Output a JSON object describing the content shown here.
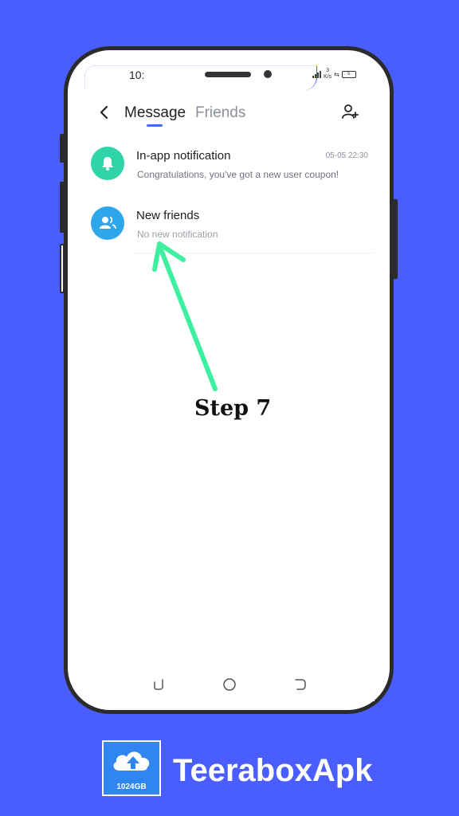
{
  "status_bar": {
    "time": "10:",
    "network_speed_value": "3",
    "network_speed_unit": "K/s",
    "battery_level": "5"
  },
  "header": {
    "tabs": [
      {
        "label": "Message",
        "active": true
      },
      {
        "label": "Friends",
        "active": false
      }
    ]
  },
  "notifications": [
    {
      "title": "In-app notification",
      "subtitle": "Congratulations, you've got a new user coupon!",
      "timestamp": "05-05  22:30",
      "icon": "bell-icon",
      "color": "#2fd5a8"
    },
    {
      "title": "New friends",
      "subtitle": "No new notification",
      "timestamp": "",
      "icon": "people-icon",
      "color": "#2ea6ea"
    }
  ],
  "annotation": {
    "label": "Step 7",
    "arrow_color": "#3df0a0"
  },
  "branding": {
    "logo_caption": "1024GB",
    "name": "TeeraboxApk"
  },
  "colors": {
    "background": "#4a5dff",
    "accent": "#3b6df5"
  }
}
